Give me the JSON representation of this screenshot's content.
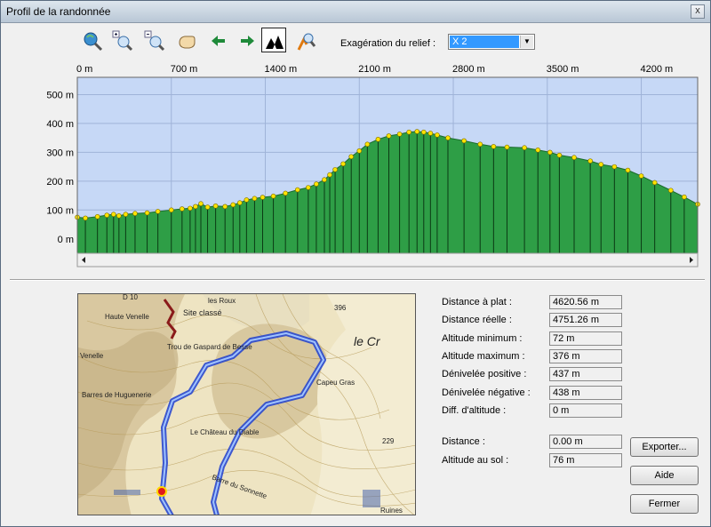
{
  "window": {
    "title": "Profil de la randonnée",
    "close_label": "x"
  },
  "toolbar": {
    "tools": [
      "locate-icon",
      "zoom-in-icon",
      "zoom-out-icon",
      "pan-hand-icon",
      "arrow-left-icon",
      "arrow-right-icon",
      "terrain-view-icon",
      "hiker-search-icon"
    ],
    "exaggeration_label": "Exagération du relief :",
    "exaggeration_value": "X 2"
  },
  "chart_data": {
    "type": "area",
    "title": "",
    "xlabel": "",
    "ylabel": "",
    "x_unit": "m",
    "y_unit": "m",
    "x_ticks": [
      "0 m",
      "700 m",
      "1400 m",
      "2100 m",
      "2800 m",
      "3500 m",
      "4200 m"
    ],
    "x_tick_values": [
      0,
      700,
      1400,
      2100,
      2800,
      3500,
      4200
    ],
    "y_ticks": [
      "0 m",
      "100 m",
      "200 m",
      "300 m",
      "400 m",
      "500 m"
    ],
    "y_tick_values": [
      0,
      100,
      200,
      300,
      400,
      500
    ],
    "xlim": [
      0,
      4620
    ],
    "ylim": [
      -50,
      560
    ],
    "grid": true,
    "series": [
      {
        "fill": "#2e9e46",
        "x": [
          0,
          60,
          150,
          220,
          270,
          310,
          360,
          430,
          520,
          600,
          700,
          780,
          840,
          880,
          920,
          970,
          1030,
          1100,
          1160,
          1210,
          1260,
          1320,
          1380,
          1460,
          1550,
          1640,
          1720,
          1780,
          1840,
          1880,
          1920,
          1980,
          2040,
          2100,
          2160,
          2240,
          2320,
          2400,
          2470,
          2530,
          2580,
          2630,
          2680,
          2760,
          2880,
          3000,
          3100,
          3200,
          3330,
          3430,
          3520,
          3590,
          3700,
          3820,
          3900,
          4000,
          4100,
          4200,
          4300,
          4420,
          4520,
          4620
        ],
        "y": [
          75,
          72,
          77,
          82,
          85,
          80,
          85,
          88,
          90,
          95,
          100,
          104,
          106,
          112,
          122,
          110,
          114,
          112,
          118,
          125,
          135,
          140,
          144,
          148,
          158,
          170,
          178,
          190,
          205,
          222,
          240,
          260,
          285,
          305,
          328,
          345,
          357,
          363,
          370,
          372,
          370,
          366,
          360,
          350,
          340,
          328,
          320,
          318,
          316,
          308,
          300,
          290,
          282,
          270,
          258,
          250,
          238,
          218,
          195,
          168,
          145,
          120
        ]
      }
    ]
  },
  "stats": [
    {
      "label": "Distance à plat :",
      "value": "4620.56 m"
    },
    {
      "label": "Distance réelle :",
      "value": "4751.26 m"
    },
    {
      "label": "Altitude minimum :",
      "value": "72 m"
    },
    {
      "label": "Altitude maximum :",
      "value": "376 m"
    },
    {
      "label": "Dénivelée positive :",
      "value": "437 m"
    },
    {
      "label": "Dénivelée négative :",
      "value": "438 m"
    },
    {
      "label": "Diff. d'altitude :",
      "value": "0 m"
    }
  ],
  "cursor": [
    {
      "label": "Distance :",
      "value": "0.00 m"
    },
    {
      "label": "Altitude au sol :",
      "value": "76 m"
    }
  ],
  "buttons": {
    "export": "Exporter...",
    "help": "Aide",
    "close": "Fermer"
  },
  "map": {
    "labels": [
      "Haute Venelle",
      "Site classé",
      "les Roux",
      "Trou de Gaspard de Besse",
      "Venelle",
      "Barres de Huguenerie",
      "Le Château du Diable",
      "Capeu Gras",
      "le Cr",
      "396",
      "229",
      "Barre du Sonnette",
      "Ruines",
      "D 10"
    ]
  }
}
